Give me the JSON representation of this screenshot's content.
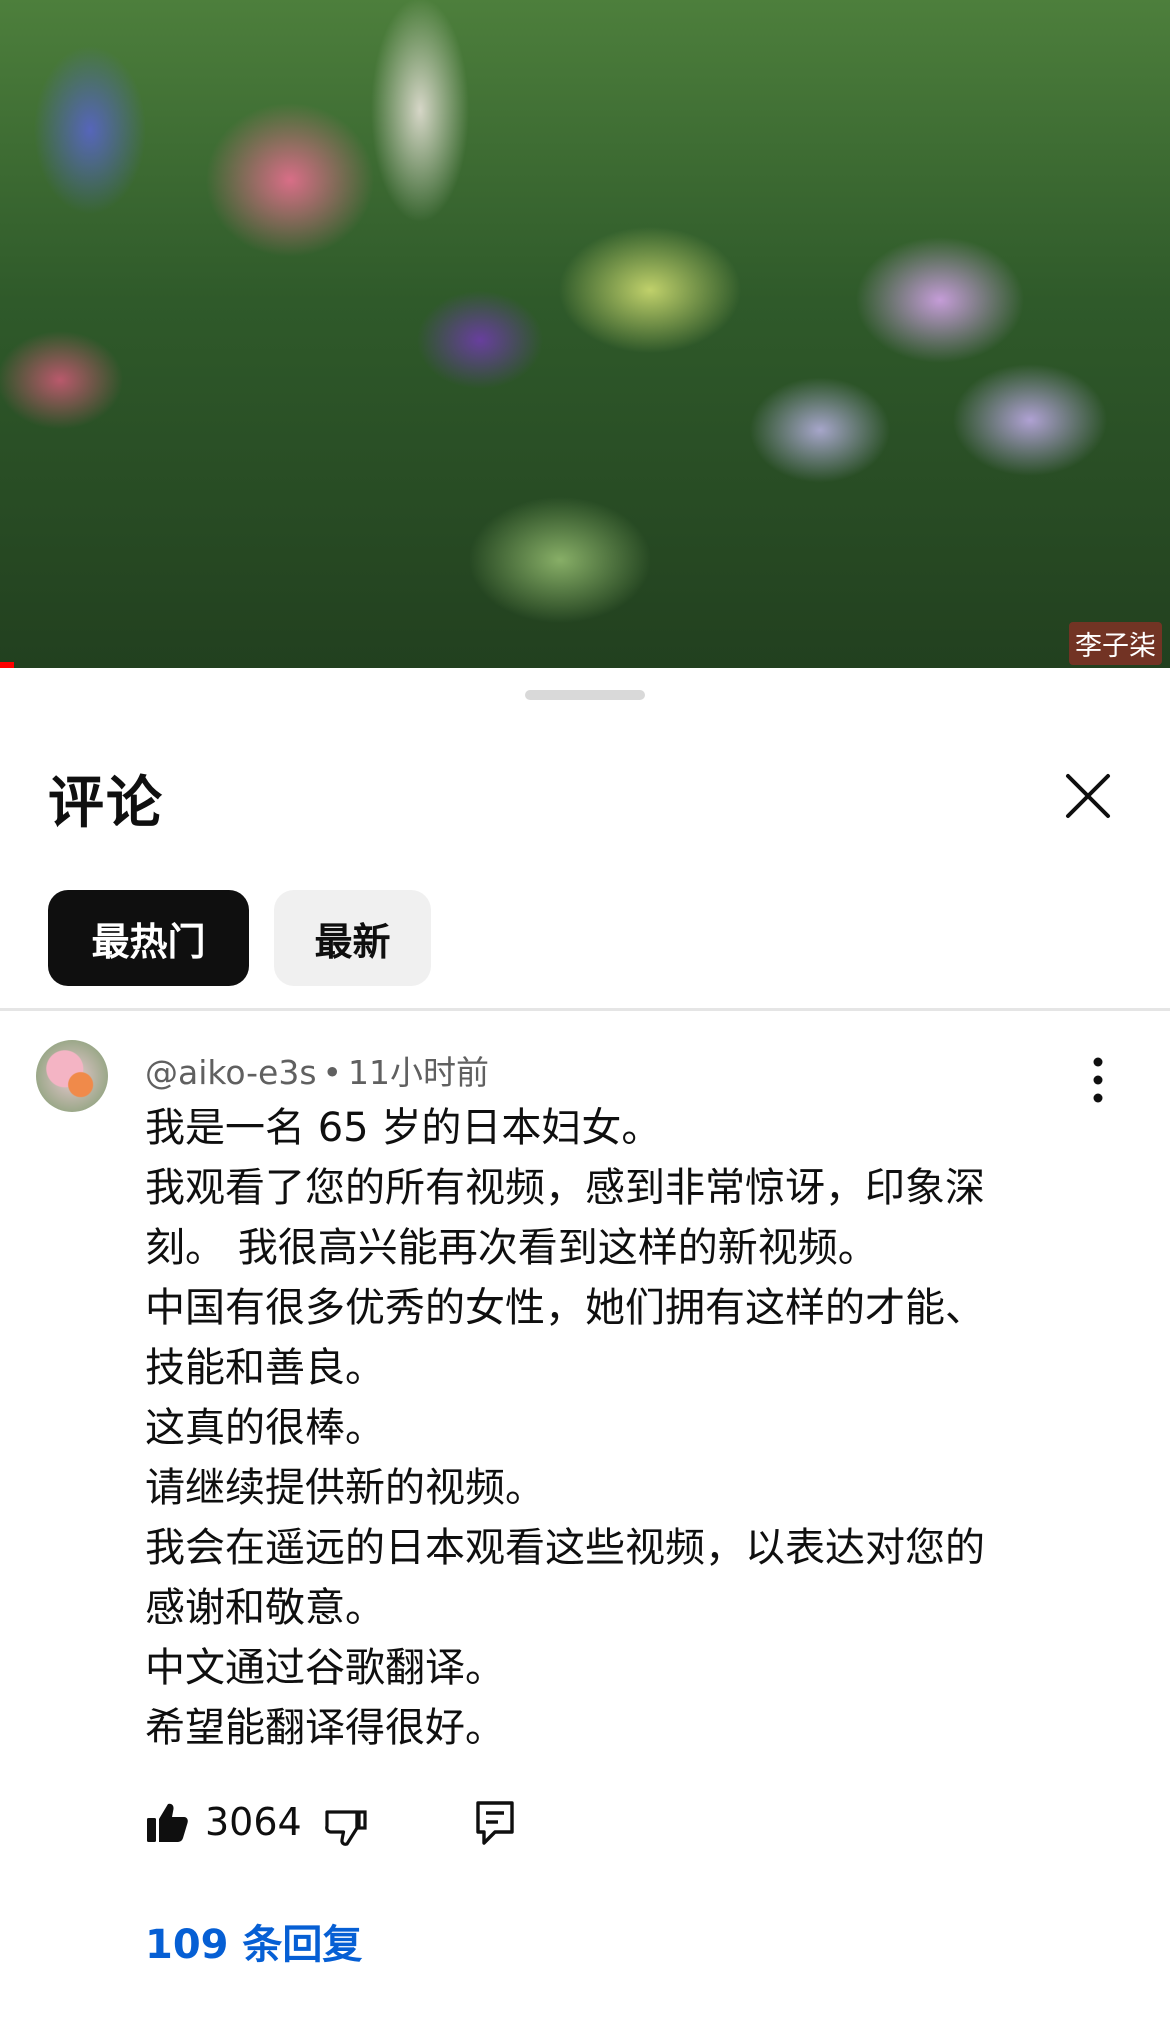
{
  "video": {
    "watermark": "李子柒"
  },
  "sheet": {
    "title": "评论",
    "close_icon": "close-icon",
    "sort_chips": [
      {
        "label": "最热门",
        "selected": true
      },
      {
        "label": "最新",
        "selected": false
      }
    ]
  },
  "comment": {
    "author": "@aiko-e3s",
    "separator": "•",
    "time": "11小时前",
    "lines": [
      "我是一名 65 岁的日本妇女。",
      "我观看了您的所有视频，感到非常惊讶，印象深",
      "刻。 我很高兴能再次看到这样的新视频。",
      "中国有很多优秀的女性，她们拥有这样的才能、",
      "技能和善良。",
      "这真的很棒。",
      "请继续提供新的视频。",
      "我会在遥远的日本观看这些视频，以表达对您的",
      "感谢和敬意。",
      "中文通过谷歌翻译。",
      "希望能翻译得很好。"
    ],
    "like_count": "3064",
    "replies_label": "109 条回复"
  },
  "colors": {
    "accent_link": "#065fd4",
    "progress": "#ff0000",
    "chip_selected_bg": "#0f0f0f",
    "chip_bg": "#f0f0f0"
  }
}
